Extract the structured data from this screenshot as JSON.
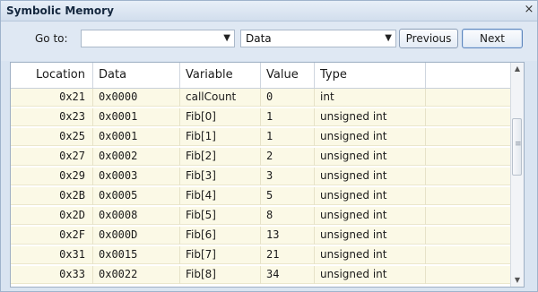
{
  "window": {
    "title": "Symbolic Memory",
    "close_glyph": "×"
  },
  "toolbar": {
    "goto_label": "Go to:",
    "goto_value": "",
    "data_value": "Data",
    "previous_label": "Previous",
    "next_label": "Next",
    "dropdown_glyph": "▼"
  },
  "table": {
    "columns": [
      "Location",
      "Data",
      "Variable",
      "Value",
      "Type",
      ""
    ],
    "rows": [
      {
        "location": "0x21",
        "data": "0x0000",
        "variable": "callCount",
        "value": "0",
        "type": "int"
      },
      {
        "location": "0x23",
        "data": "0x0001",
        "variable": "Fib[0]",
        "value": "1",
        "type": "unsigned int"
      },
      {
        "location": "0x25",
        "data": "0x0001",
        "variable": "Fib[1]",
        "value": "1",
        "type": "unsigned int"
      },
      {
        "location": "0x27",
        "data": "0x0002",
        "variable": "Fib[2]",
        "value": "2",
        "type": "unsigned int"
      },
      {
        "location": "0x29",
        "data": "0x0003",
        "variable": "Fib[3]",
        "value": "3",
        "type": "unsigned int"
      },
      {
        "location": "0x2B",
        "data": "0x0005",
        "variable": "Fib[4]",
        "value": "5",
        "type": "unsigned int"
      },
      {
        "location": "0x2D",
        "data": "0x0008",
        "variable": "Fib[5]",
        "value": "8",
        "type": "unsigned int"
      },
      {
        "location": "0x2F",
        "data": "0x000D",
        "variable": "Fib[6]",
        "value": "13",
        "type": "unsigned int"
      },
      {
        "location": "0x31",
        "data": "0x0015",
        "variable": "Fib[7]",
        "value": "21",
        "type": "unsigned int"
      },
      {
        "location": "0x33",
        "data": "0x0022",
        "variable": "Fib[8]",
        "value": "34",
        "type": "unsigned int"
      }
    ]
  },
  "scrollbar": {
    "up_glyph": "▲",
    "down_glyph": "▼",
    "grip_glyph": "≡"
  },
  "colors": {
    "row_background": "#fbf9e6",
    "window_background": "#d9e4f1"
  }
}
